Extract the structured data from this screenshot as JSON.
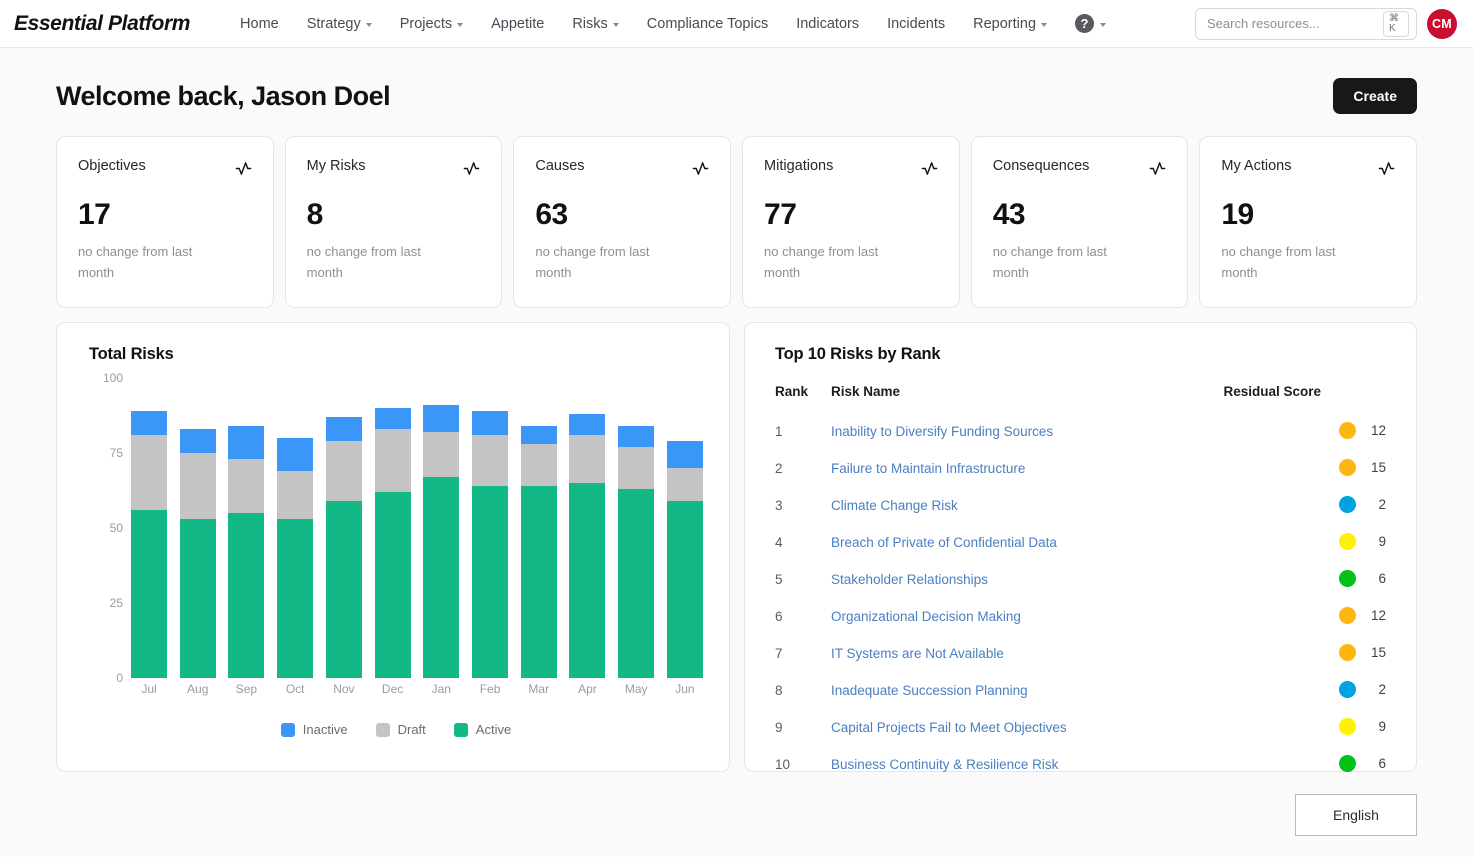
{
  "navbar": {
    "brand": "Essential Platform",
    "links": [
      {
        "label": "Home",
        "has_caret": false
      },
      {
        "label": "Strategy",
        "has_caret": true
      },
      {
        "label": "Projects",
        "has_caret": true
      },
      {
        "label": "Appetite",
        "has_caret": false
      },
      {
        "label": "Risks",
        "has_caret": true
      },
      {
        "label": "Compliance Topics",
        "has_caret": false
      },
      {
        "label": "Indicators",
        "has_caret": false
      },
      {
        "label": "Incidents",
        "has_caret": false
      },
      {
        "label": "Reporting",
        "has_caret": true
      }
    ],
    "help_glyph": "?",
    "search": {
      "placeholder": "Search resources...",
      "value": "",
      "shortcut": "⌘ K"
    },
    "avatar_initials": "CM",
    "avatar_color": "#c8102e"
  },
  "header": {
    "title": "Welcome back, Jason Doel",
    "create_label": "Create"
  },
  "metric_cards": [
    {
      "title": "Objectives",
      "value": "17",
      "subtitle": "no change from last month"
    },
    {
      "title": "My Risks",
      "value": "8",
      "subtitle": "no change from last month"
    },
    {
      "title": "Causes",
      "value": "63",
      "subtitle": "no change from last month"
    },
    {
      "title": "Mitigations",
      "value": "77",
      "subtitle": "no change from last month"
    },
    {
      "title": "Consequences",
      "value": "43",
      "subtitle": "no change from last month"
    },
    {
      "title": "My Actions",
      "value": "19",
      "subtitle": "no change from last month"
    }
  ],
  "chart_panel": {
    "title": "Total Risks"
  },
  "chart_data": {
    "type": "bar",
    "title": "Total Risks",
    "stacked": true,
    "xlabel": "",
    "ylabel": "",
    "ylim": [
      0,
      100
    ],
    "yticks": [
      0,
      25,
      50,
      75,
      100
    ],
    "grid": false,
    "legend_position": "bottom",
    "categories": [
      "Jul",
      "Aug",
      "Sep",
      "Oct",
      "Nov",
      "Dec",
      "Jan",
      "Feb",
      "Mar",
      "Apr",
      "May",
      "Jun"
    ],
    "series": [
      {
        "name": "Active",
        "color": "#12b886",
        "values": [
          56,
          53,
          55,
          53,
          59,
          62,
          67,
          64,
          64,
          65,
          63,
          59
        ]
      },
      {
        "name": "Draft",
        "color": "#c4c4c4",
        "values": [
          25,
          22,
          18,
          16,
          20,
          21,
          15,
          17,
          14,
          16,
          14,
          11
        ]
      },
      {
        "name": "Inactive",
        "color": "#3b97f7",
        "values": [
          8,
          8,
          11,
          11,
          8,
          7,
          9,
          8,
          6,
          7,
          7,
          9
        ]
      }
    ],
    "legend": [
      {
        "label": "Inactive",
        "color": "#3b97f7"
      },
      {
        "label": "Draft",
        "color": "#c4c4c4"
      },
      {
        "label": "Active",
        "color": "#12b886"
      }
    ]
  },
  "risks_panel": {
    "title": "Top 10 Risks by Rank",
    "columns": {
      "rank": "Rank",
      "name": "Risk Name",
      "score": "Residual Score"
    },
    "rows": [
      {
        "rank": "1",
        "name": "Inability to Diversify Funding Sources",
        "score": "12",
        "color": "#FFB612"
      },
      {
        "rank": "2",
        "name": "Failure to Maintain Infrastructure",
        "score": "15",
        "color": "#FFB612"
      },
      {
        "rank": "3",
        "name": "Climate Change Risk",
        "score": "2",
        "color": "#00A3E0"
      },
      {
        "rank": "4",
        "name": "Breach of Private of Confidential Data",
        "score": "9",
        "color": "#FFF200"
      },
      {
        "rank": "5",
        "name": "Stakeholder Relationships",
        "score": "6",
        "color": "#00C217"
      },
      {
        "rank": "6",
        "name": "Organizational Decision Making",
        "score": "12",
        "color": "#FFB612"
      },
      {
        "rank": "7",
        "name": "IT Systems are Not Available",
        "score": "15",
        "color": "#FFB612"
      },
      {
        "rank": "8",
        "name": "Inadequate Succession Planning",
        "score": "2",
        "color": "#00A3E0"
      },
      {
        "rank": "9",
        "name": "Capital Projects Fail to Meet Objectives",
        "score": "9",
        "color": "#FFF200"
      },
      {
        "rank": "10",
        "name": "Business Continuity & Resilience Risk",
        "score": "6",
        "color": "#00C217"
      }
    ]
  },
  "footer": {
    "language": "English"
  }
}
